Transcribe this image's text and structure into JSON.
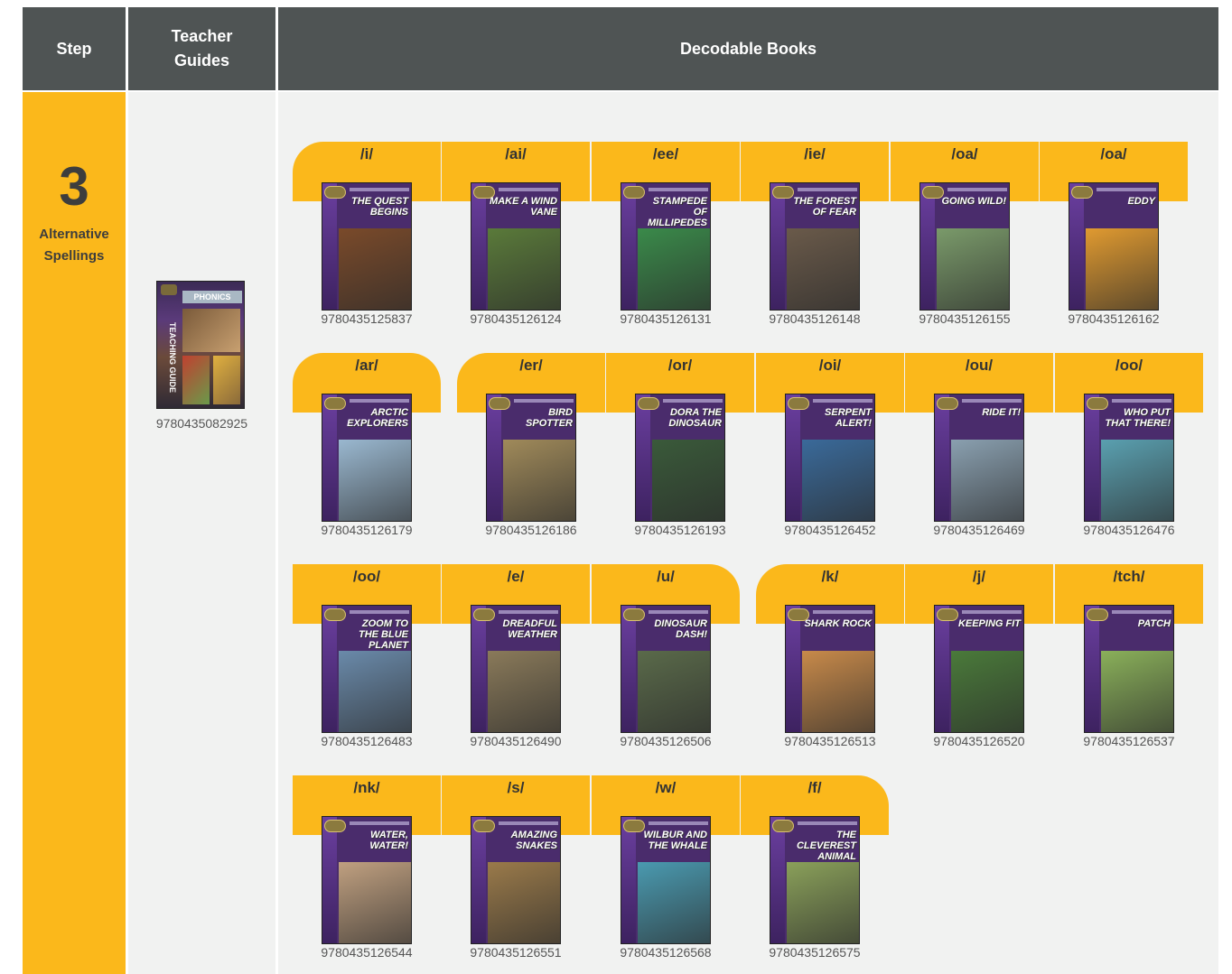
{
  "header": {
    "step": "Step",
    "teacher_guides": "Teacher Guides",
    "decodable_books": "Decodable Books"
  },
  "step": {
    "number": "3",
    "name": "Alternative Spellings"
  },
  "teacher_guide": {
    "cover_label": "PHONICS",
    "cover_side": "TEACHING GUIDE",
    "isbn": "9780435082925"
  },
  "books": [
    {
      "sound": "/i/",
      "title": "THE QUEST BEGINS",
      "isbn": "9780435125837",
      "art": "#7a4a2a"
    },
    {
      "sound": "/ai/",
      "title": "MAKE A WIND VANE",
      "isbn": "9780435126124",
      "art": "#5a7a3a"
    },
    {
      "sound": "/ee/",
      "title": "STAMPEDE OF MILLIPEDES",
      "isbn": "9780435126131",
      "art": "#3a8a4a"
    },
    {
      "sound": "/ie/",
      "title": "THE FOREST OF FEAR",
      "isbn": "9780435126148",
      "art": "#6a5a4a"
    },
    {
      "sound": "/oa/",
      "title": "GOING WILD!",
      "isbn": "9780435126155",
      "art": "#7a9a6a"
    },
    {
      "sound": "/oa/",
      "title": "EDDY",
      "isbn": "9780435126162",
      "art": "#e09a30"
    },
    {
      "sound": "/ar/",
      "title": "ARCTIC EXPLORERS",
      "isbn": "9780435126179",
      "art": "#9ab8d0"
    },
    {
      "sound": "/er/",
      "title": "BIRD SPOTTER",
      "isbn": "9780435126186",
      "art": "#a08a5a"
    },
    {
      "sound": "/or/",
      "title": "DORA THE DINOSAUR",
      "isbn": "9780435126193",
      "art": "#3a5a3a"
    },
    {
      "sound": "/oi/",
      "title": "SERPENT ALERT!",
      "isbn": "9780435126452",
      "art": "#3a6a9a"
    },
    {
      "sound": "/ou/",
      "title": "RIDE IT!",
      "isbn": "9780435126469",
      "art": "#8aa0b0"
    },
    {
      "sound": "/oo/",
      "title": "WHO PUT THAT THERE!",
      "isbn": "9780435126476",
      "art": "#5aa0b0"
    },
    {
      "sound": "/oo/",
      "title": "ZOOM TO THE BLUE PLANET",
      "isbn": "9780435126483",
      "art": "#6a8aaa"
    },
    {
      "sound": "/e/",
      "title": "DREADFUL WEATHER",
      "isbn": "9780435126490",
      "art": "#8a7a5a"
    },
    {
      "sound": "/u/",
      "title": "DINOSAUR DASH!",
      "isbn": "9780435126506",
      "art": "#5a6a4a"
    },
    {
      "sound": "/k/",
      "title": "SHARK ROCK",
      "isbn": "9780435126513",
      "art": "#c88a4a"
    },
    {
      "sound": "/j/",
      "title": "KEEPING FIT",
      "isbn": "9780435126520",
      "art": "#4a7a3a"
    },
    {
      "sound": "/tch/",
      "title": "PATCH",
      "isbn": "9780435126537",
      "art": "#8ab05a"
    },
    {
      "sound": "/nk/",
      "title": "WATER, WATER!",
      "isbn": "9780435126544",
      "art": "#c0a080"
    },
    {
      "sound": "/s/",
      "title": "AMAZING SNAKES",
      "isbn": "9780435126551",
      "art": "#9a7a4a"
    },
    {
      "sound": "/w/",
      "title": "WILBUR AND THE WHALE",
      "isbn": "9780435126568",
      "art": "#4a9ab0"
    },
    {
      "sound": "/f/",
      "title": "THE CLEVEREST ANIMAL",
      "isbn": "9780435126575",
      "art": "#8aa05a"
    }
  ],
  "colors": {
    "header_bg": "#4f5454",
    "accent": "#fbb81b",
    "panel_bg": "#f1f2f1",
    "cover_purple": "#4a2c6c"
  }
}
